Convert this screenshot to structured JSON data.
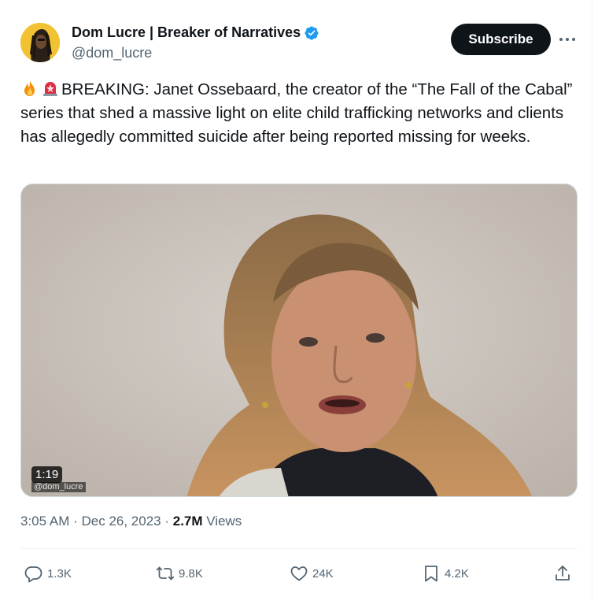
{
  "author": {
    "display_name": "Dom Lucre | Breaker of Narratives",
    "handle": "@dom_lucre",
    "verified_icon": "verified-badge-icon",
    "avatar_icon": "avatar"
  },
  "header": {
    "subscribe_label": "Subscribe",
    "more_icon": "more-icon"
  },
  "tweet": {
    "emojis": [
      "fire-emoji",
      "siren-emoji"
    ],
    "text": "BREAKING: Janet Ossebaard, the creator of the “The Fall of the Cabal” series that shed a massive light on elite child trafficking networks and clients has allegedly committed suicide after being reported missing for weeks."
  },
  "media": {
    "duration": "1:19",
    "watermark": "@dom_lucre"
  },
  "meta": {
    "time": "3:05 AM",
    "date": "Dec 26, 2023",
    "separator": " · ",
    "views_count": "2.7M",
    "views_label": " Views"
  },
  "actions": {
    "replies": "1.3K",
    "reposts": "9.8K",
    "likes": "24K",
    "bookmarks": "4.2K"
  },
  "colors": {
    "text_primary": "#0f1419",
    "text_secondary": "#536471",
    "verified_blue": "#1d9bf0",
    "button_black": "#0f1419"
  }
}
